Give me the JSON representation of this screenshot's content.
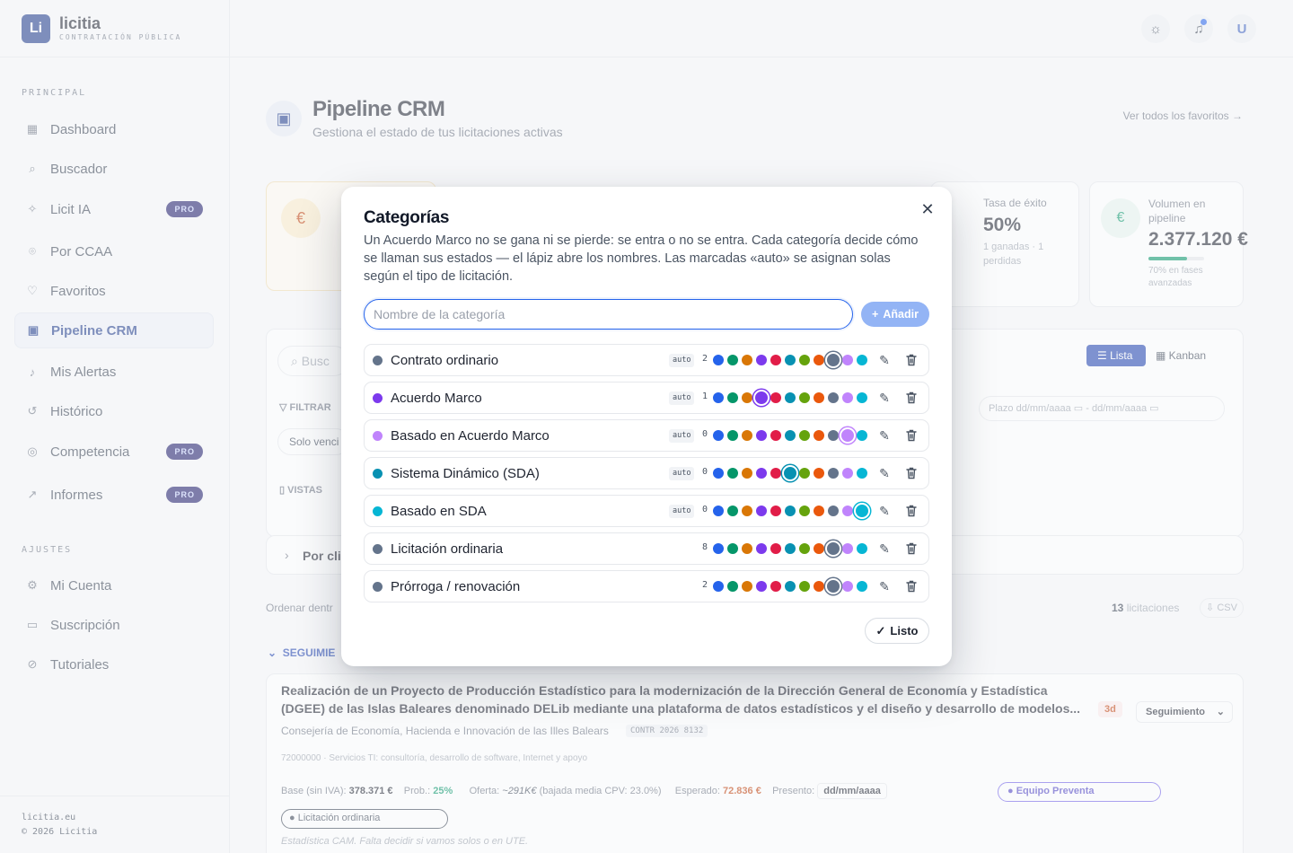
{
  "brand": {
    "logo": "Li",
    "name": "licitia",
    "subtitle": "CONTRATACIÓN PÚBLICA"
  },
  "sidebar": {
    "section_principal": "PRINCIPAL",
    "section_ajustes": "AJUSTES",
    "items": [
      {
        "label": "Dashboard",
        "icon": "grid-icon"
      },
      {
        "label": "Buscador",
        "icon": "search-icon"
      },
      {
        "label": "Licit IA",
        "icon": "sparkles-icon",
        "badge": "PRO"
      },
      {
        "label": "Por CCAA",
        "icon": "map-pin-icon"
      },
      {
        "label": "Favoritos",
        "icon": "heart-icon"
      },
      {
        "label": "Pipeline CRM",
        "icon": "briefcase-icon",
        "active": true
      },
      {
        "label": "Mis Alertas",
        "icon": "bell-icon"
      },
      {
        "label": "Histórico",
        "icon": "history-icon"
      },
      {
        "label": "Competencia",
        "icon": "target-icon",
        "badge": "PRO"
      },
      {
        "label": "Informes",
        "icon": "chart-icon",
        "badge": "PRO"
      }
    ],
    "settings": [
      {
        "label": "Mi Cuenta",
        "icon": "gear-icon"
      },
      {
        "label": "Suscripción",
        "icon": "card-icon"
      },
      {
        "label": "Tutoriales",
        "icon": "compass-icon"
      }
    ],
    "footer_site": "licitia.eu",
    "footer_copy": "© 2026 Licitia"
  },
  "topbar": {
    "avatar": "U"
  },
  "page": {
    "title": "Pipeline CRM",
    "subtitle": "Gestiona el estado de tus licitaciones activas",
    "fav_link": "Ver todos los favoritos →"
  },
  "background": {
    "stat_success_label": "Tasa de éxito",
    "stat_success_value": "50%",
    "stat_success_sub": "1 ganadas · 1 perdidas",
    "stat_volume_label": "Volumen en pipeline",
    "stat_volume_value": "2.377.120 €",
    "stat_volume_sub": "70% en fases avanzadas",
    "search_placeholder": "Busc",
    "filter_label": "FILTRAR",
    "solo_venc": "Solo venci",
    "vistas_label": "VISTAS",
    "btn_lista": "Lista",
    "btn_kanban": "Kanban",
    "plazo_label": "Plazo dd/mm/aaaa",
    "plazo_to": "dd/mm/aaaa",
    "group_title": "Por cli",
    "order_label": "Ordenar dentr",
    "count_bold": "13",
    "count_label": "licitaciones",
    "csv": "CSV",
    "section_seg": "SEGUIMIE",
    "row_title": "Realización de un Proyecto de Producción Estadístico para la modernización de la Dirección General de Economía y Estadística (DGEE) de las Islas Baleares denominado DELib mediante una plataforma de datos estadísticos y el diseño y desarrollo de modelos...",
    "row_org": "Consejería de Economía, Hacienda e Innovación de las Illes Balears",
    "row_code": "CONTR 2026 8132",
    "row_cpv": "72000000 · Servicios TI: consultoría, desarrollo de software, Internet y apoyo",
    "row_days": "3d",
    "row_status": "Seguimiento",
    "row_base_label": "Base (sin IVA):",
    "row_base": "378.371 €",
    "row_prob_label": "Prob.:",
    "row_prob": "25%",
    "row_oferta_label": "Oferta:",
    "row_oferta": "~291K€",
    "row_oferta_note": "(bajada media CPV: 23.0%)",
    "row_esperado_label": "Esperado:",
    "row_esperado": "72.836 €",
    "row_presento_label": "Presento:",
    "row_presento": "dd/mm/aaaa",
    "row_team": "Equipo Preventa",
    "row_category": "Licitación ordinaria",
    "row_note": "Estadística CAM. Falta decidir si vamos solos o en UTE."
  },
  "modal": {
    "title": "Categorías",
    "description": "Un Acuerdo Marco no se gana ni se pierde: se entra o no se entra. Cada categoría decide cómo se llaman sus estados — el lápiz abre los nombres. Las marcadas «auto» se asignan solas según el tipo de licitación.",
    "input_placeholder": "Nombre de la categoría",
    "add_label": "Añadir",
    "done_label": "Listo",
    "palette": [
      "#2563eb",
      "#059669",
      "#d97706",
      "#7c3aed",
      "#e11d48",
      "#0891b2",
      "#65a30d",
      "#ea580c",
      "#64748b",
      "#c084fc",
      "#06b6d4"
    ],
    "categories": [
      {
        "name": "Contrato ordinario",
        "auto": "auto",
        "count": "2",
        "color": "#64748b",
        "selected": 8
      },
      {
        "name": "Acuerdo Marco",
        "auto": "auto",
        "count": "1",
        "color": "#7c3aed",
        "selected": 3
      },
      {
        "name": "Basado en Acuerdo Marco",
        "auto": "auto",
        "count": "0",
        "color": "#c084fc",
        "selected": 9
      },
      {
        "name": "Sistema Dinámico (SDA)",
        "auto": "auto",
        "count": "0",
        "color": "#0891b2",
        "selected": 5
      },
      {
        "name": "Basado en SDA",
        "auto": "auto",
        "count": "0",
        "color": "#06b6d4",
        "selected": 10
      },
      {
        "name": "Licitación ordinaria",
        "auto": "",
        "count": "8",
        "color": "#64748b",
        "selected": 8
      },
      {
        "name": "Prórroga / renovación",
        "auto": "",
        "count": "2",
        "color": "#64748b",
        "selected": 8
      }
    ]
  }
}
